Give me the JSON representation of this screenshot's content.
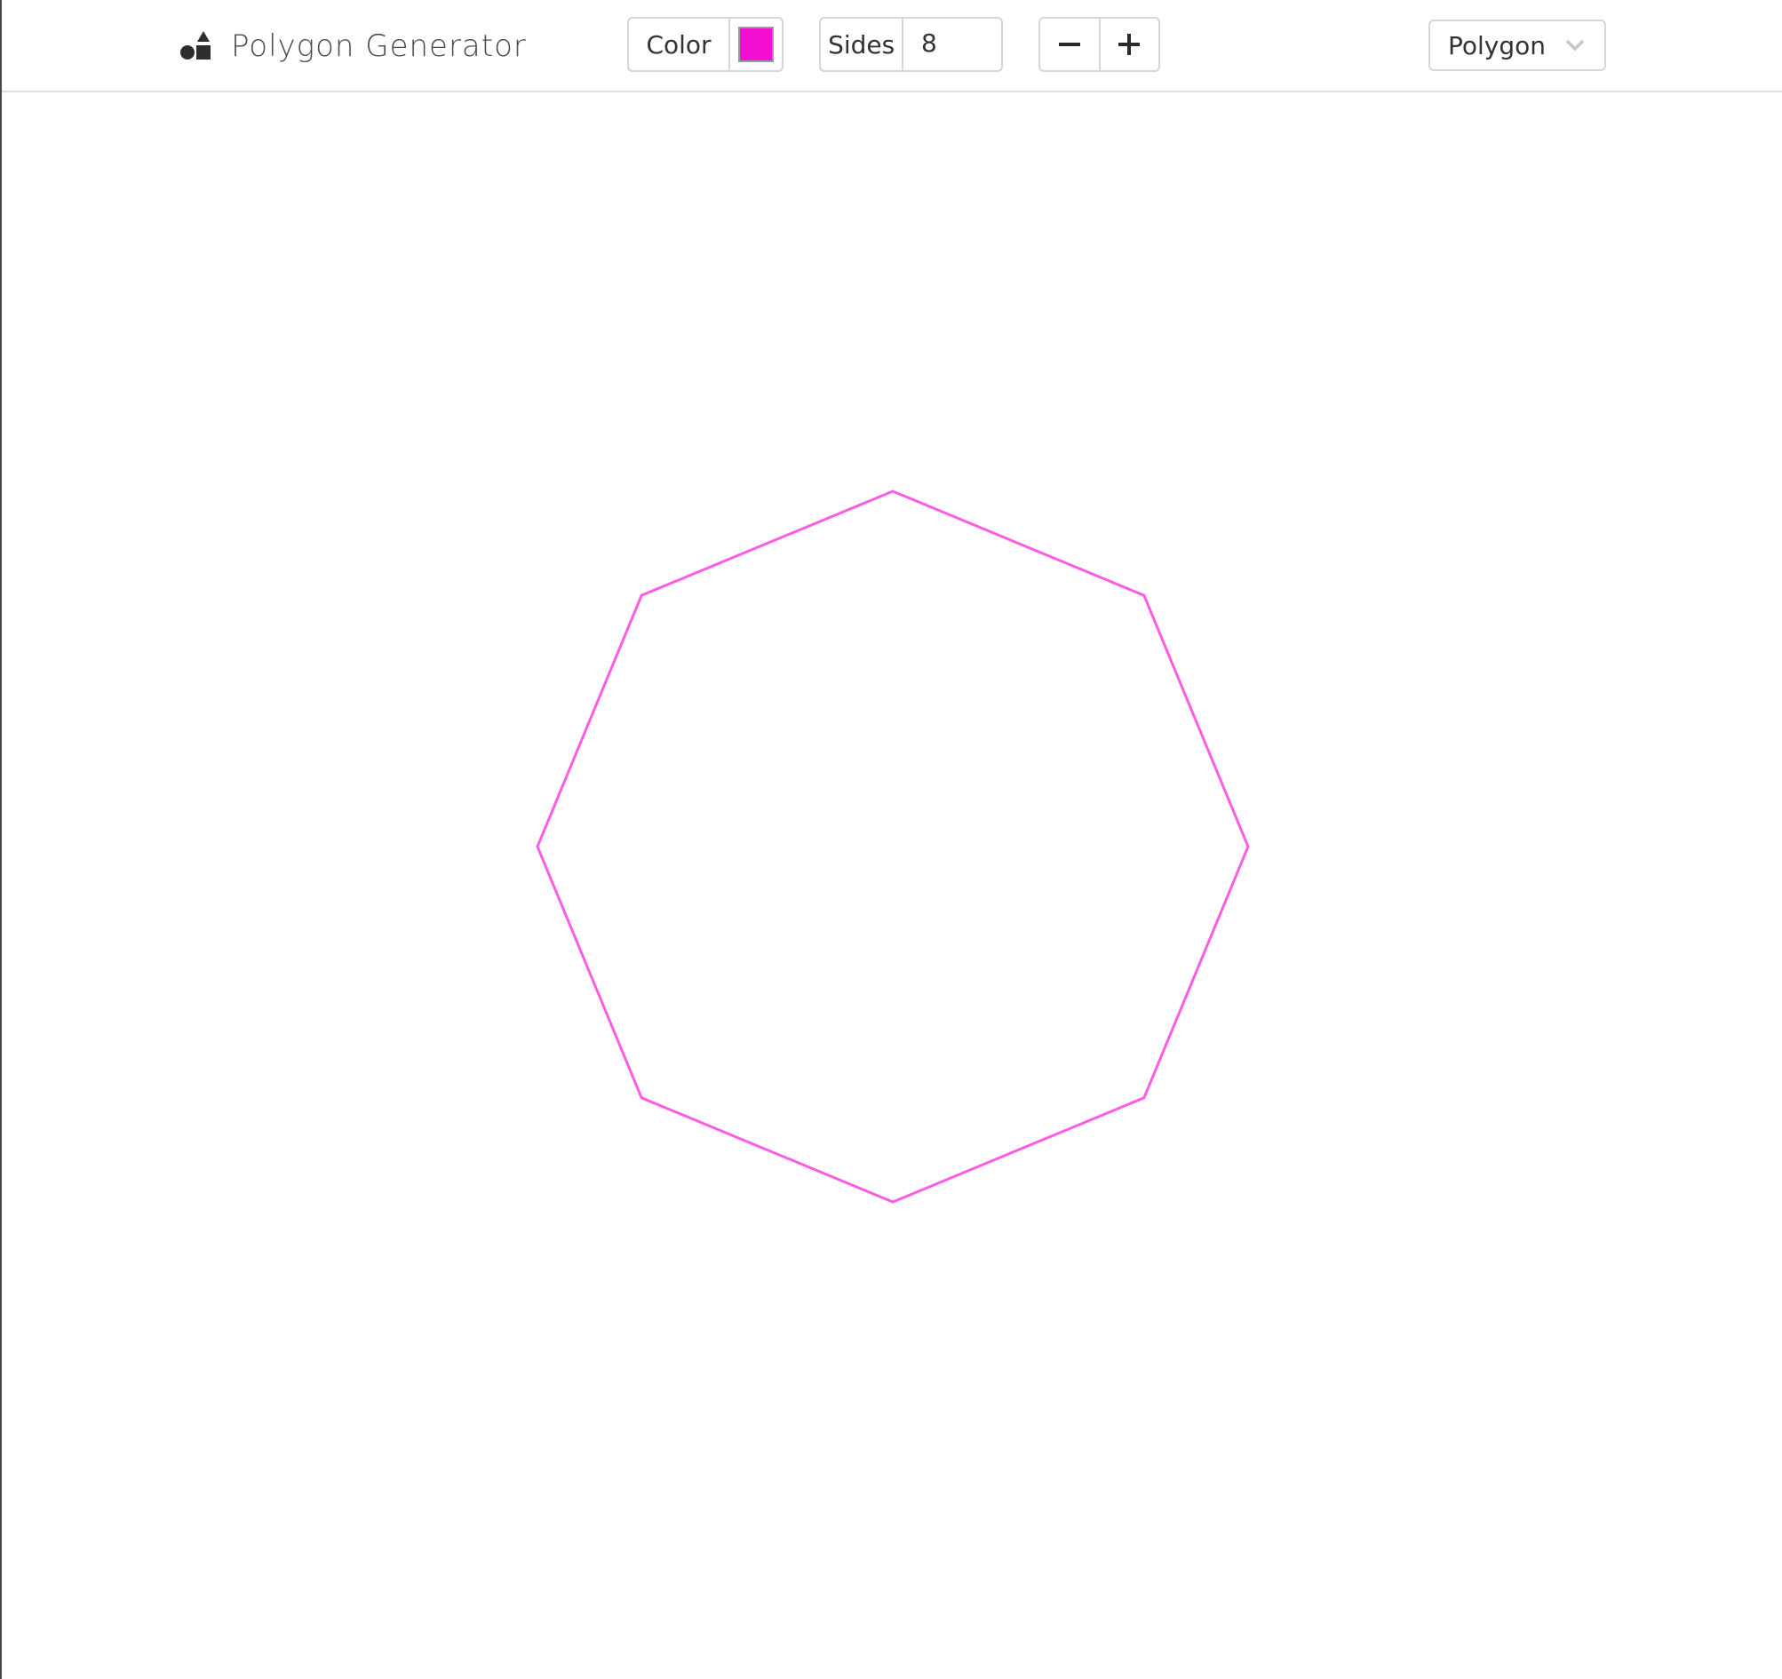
{
  "app": {
    "title": "Polygon Generator",
    "logo_icon": "shapes-icon"
  },
  "toolbar": {
    "color_label": "Color",
    "color_value": "#f20fd2",
    "sides_label": "Sides",
    "sides_value": "8",
    "decrement_icon": "minus-icon",
    "increment_icon": "plus-icon",
    "shape_select": {
      "selected": "Polygon",
      "arrow_icon": "chevron-down-icon"
    }
  },
  "canvas": {
    "shape": "polygon",
    "sides": 8,
    "stroke_color": "#ff5ce6",
    "fill": "none"
  }
}
